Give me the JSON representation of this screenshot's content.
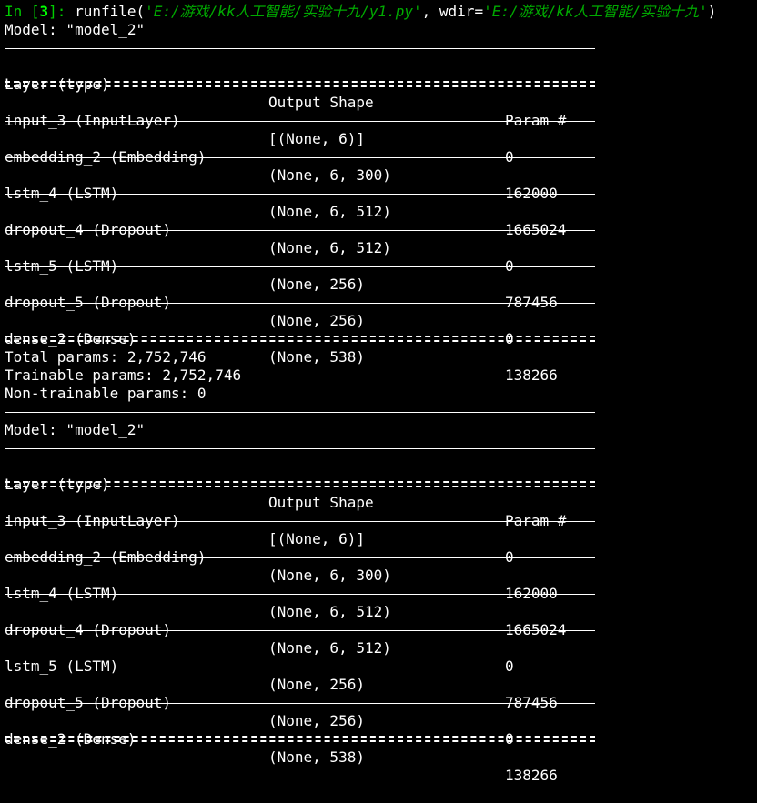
{
  "console": {
    "prompt": {
      "label": "In",
      "open": " [",
      "number": "3",
      "close": "]: ",
      "func": "runfile(",
      "file_arg": "'E:/游戏/kk人工智能/实验十九/y1.py'",
      "sep": ", wdir=",
      "wdir_arg": "'E:/游戏/kk人工智能/实验十九'",
      "end": ")"
    },
    "summaries": [
      {
        "model_line": "Model: \"model_2\"",
        "headers": [
          "Layer (type)",
          "Output Shape",
          "Param #"
        ],
        "rows": [
          [
            "input_3 (InputLayer)",
            "[(None, 6)]",
            "0"
          ],
          [
            "embedding_2 (Embedding)",
            "(None, 6, 300)",
            "162000"
          ],
          [
            "lstm_4 (LSTM)",
            "(None, 6, 512)",
            "1665024"
          ],
          [
            "dropout_4 (Dropout)",
            "(None, 6, 512)",
            "0"
          ],
          [
            "lstm_5 (LSTM)",
            "(None, 256)",
            "787456"
          ],
          [
            "dropout_5 (Dropout)",
            "(None, 256)",
            "0"
          ],
          [
            "dense_2 (Dense)",
            "(None, 538)",
            "138266"
          ]
        ],
        "totals": [
          "Total params: 2,752,746",
          "Trainable params: 2,752,746",
          "Non-trainable params: 0"
        ]
      },
      {
        "model_line": "Model: \"model_2\"",
        "headers": [
          "Layer (type)",
          "Output Shape",
          "Param #"
        ],
        "rows": [
          [
            "input_3 (InputLayer)",
            "[(None, 6)]",
            "0"
          ],
          [
            "embedding_2 (Embedding)",
            "(None, 6, 300)",
            "162000"
          ],
          [
            "lstm_4 (LSTM)",
            "(None, 6, 512)",
            "1665024"
          ],
          [
            "dropout_4 (Dropout)",
            "(None, 6, 512)",
            "0"
          ],
          [
            "lstm_5 (LSTM)",
            "(None, 256)",
            "787456"
          ],
          [
            "dropout_5 (Dropout)",
            "(None, 256)",
            "0"
          ],
          [
            "dense_2 (Dense)",
            "(None, 538)",
            "138266"
          ]
        ]
      }
    ]
  },
  "colors": {
    "background": "#000000",
    "text": "#ffffff",
    "prompt": "#00cc00",
    "string": "#00aa00"
  }
}
